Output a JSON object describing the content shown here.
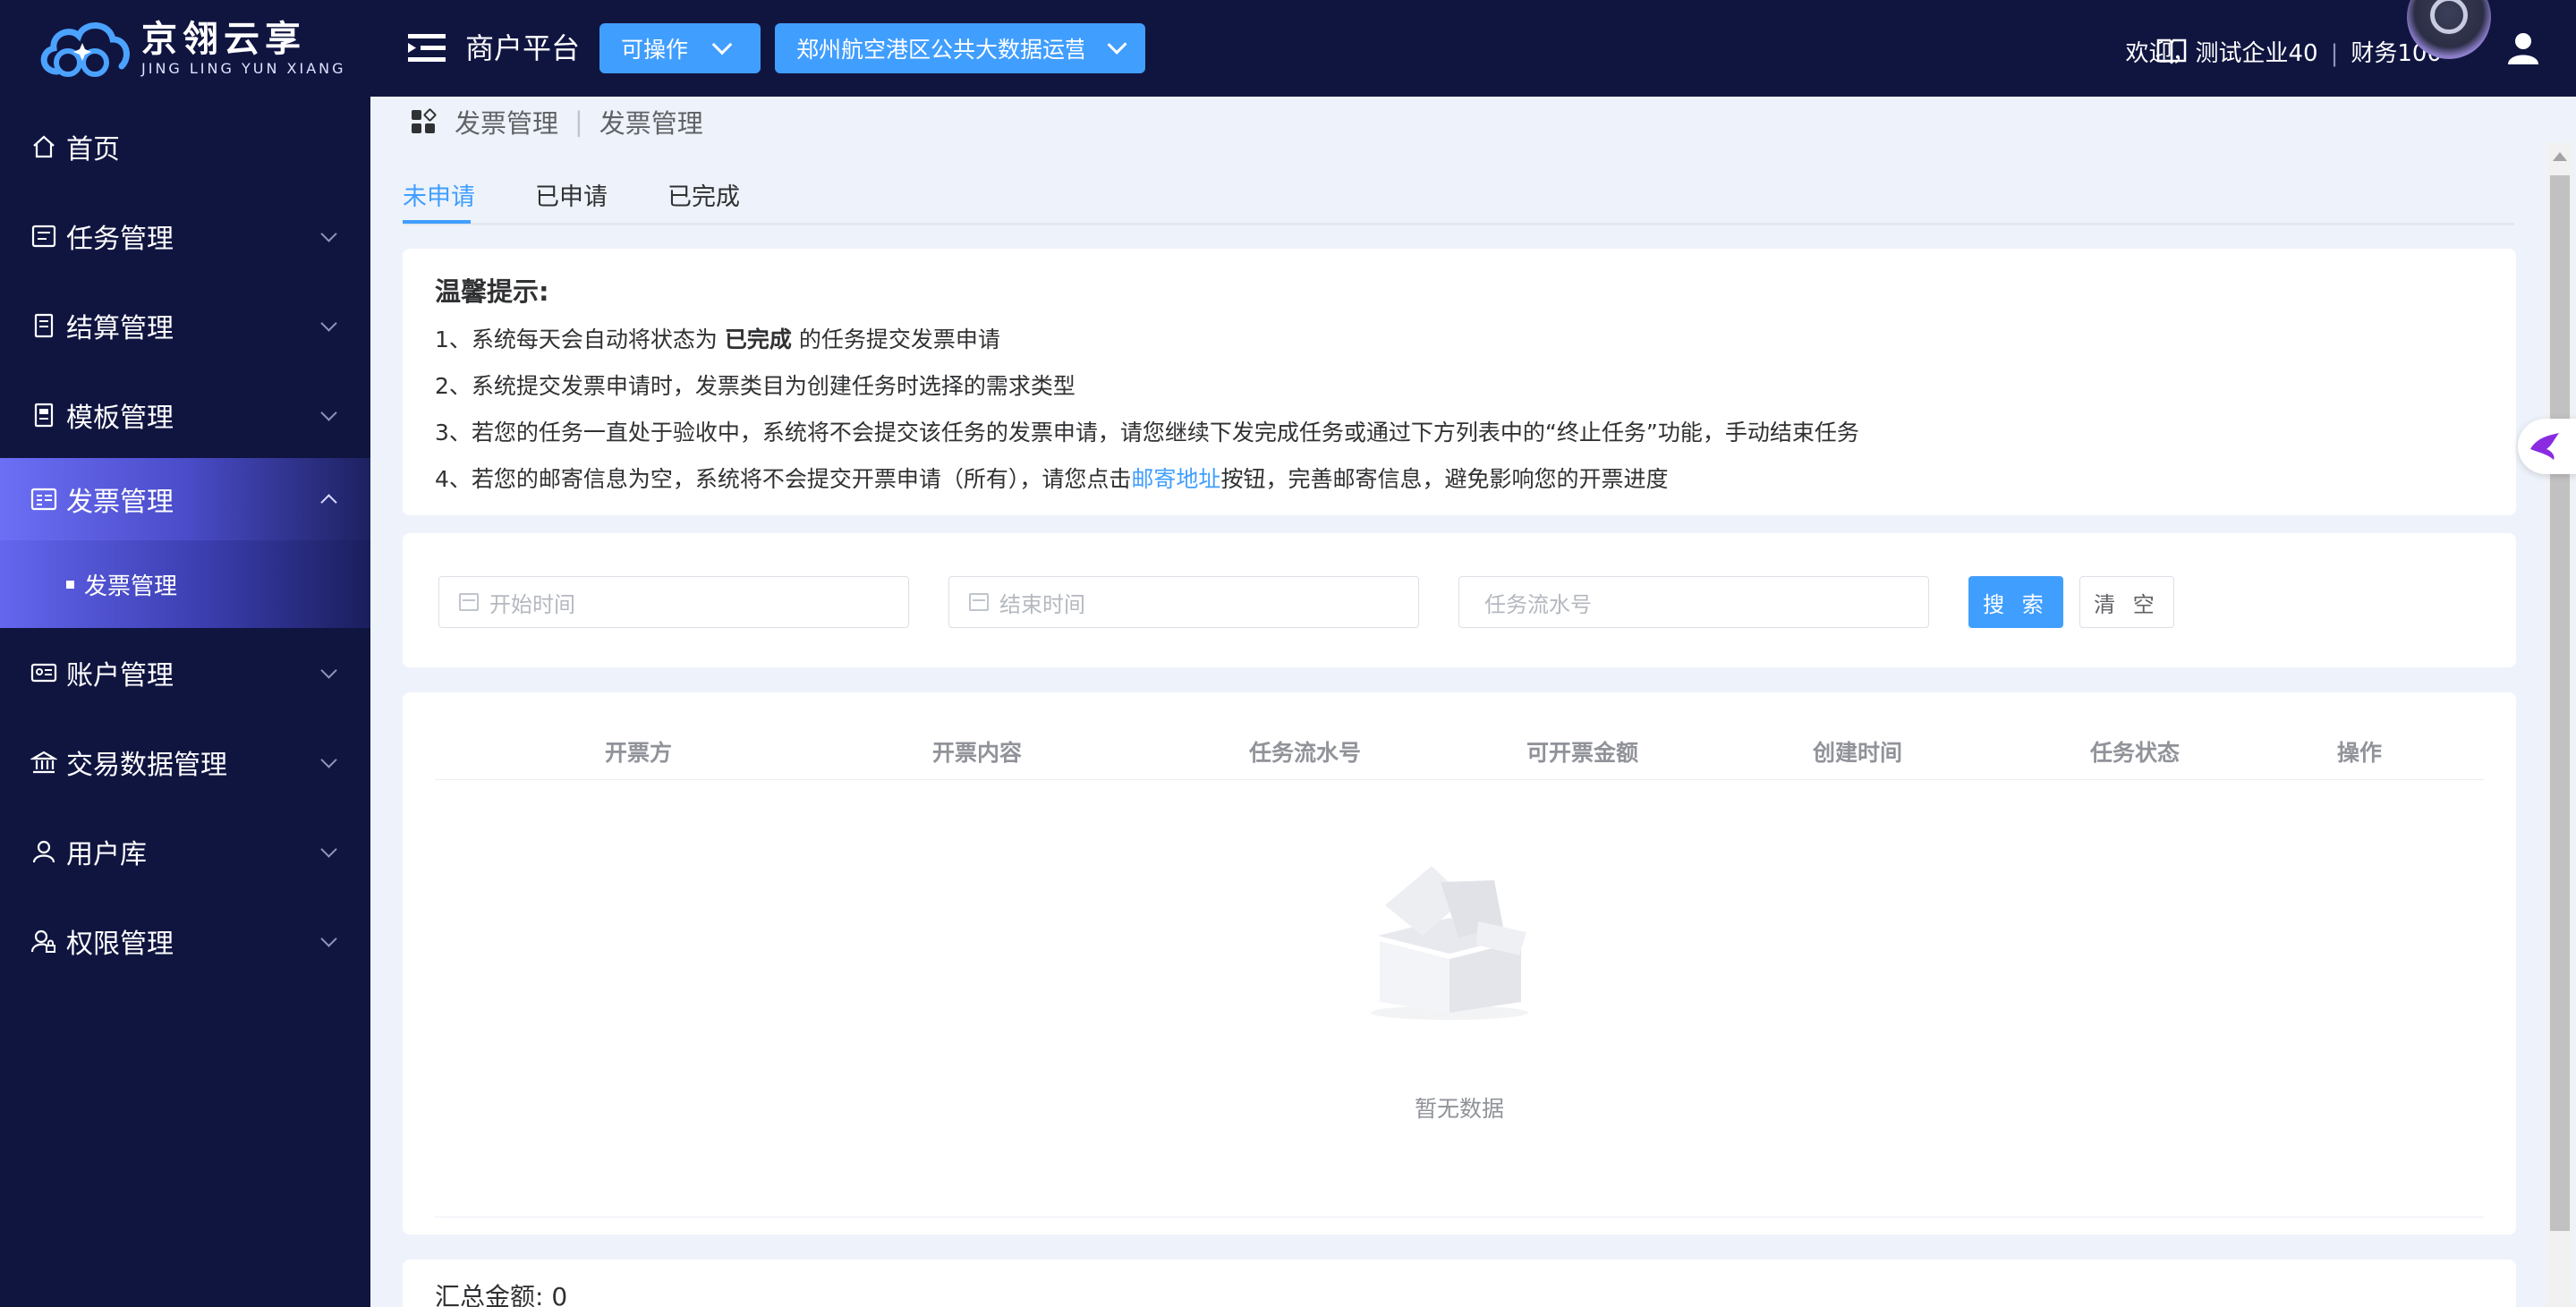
{
  "header": {
    "logo_cn": "京翎云享",
    "logo_en": "JING LING YUN XIANG",
    "platform_title": "商户平台",
    "operate_select": "可操作",
    "org_select": "郑州航空港区公共大数据运营有|",
    "welcome": "欢迎，测试企业40",
    "role": "财务100"
  },
  "sidebar": {
    "items": [
      {
        "label": "首页"
      },
      {
        "label": "任务管理"
      },
      {
        "label": "结算管理"
      },
      {
        "label": "模板管理"
      },
      {
        "label": "发票管理"
      },
      {
        "label": "账户管理"
      },
      {
        "label": "交易数据管理"
      },
      {
        "label": "用户库"
      },
      {
        "label": "权限管理"
      }
    ],
    "sub_item": "发票管理"
  },
  "breadcrumb": {
    "first": "发票管理",
    "second": "发票管理"
  },
  "tabs": [
    {
      "label": "未申请"
    },
    {
      "label": "已申请"
    },
    {
      "label": "已完成"
    }
  ],
  "tips": {
    "title": "温馨提示:",
    "line1_pre": "1、系统每天会自动将状态为 ",
    "line1_bold": "已完成",
    "line1_post": " 的任务提交发票申请",
    "line2": "2、系统提交发票申请时，发票类目为创建任务时选择的需求类型",
    "line3": "3、若您的任务一直处于验收中，系统将不会提交该任务的发票申请，请您继续下发完成任务或通过下方列表中的“终止任务”功能，手动结束任务",
    "line4_pre": "4、若您的邮寄信息为空，系统将不会提交开票申请（所有），请您点击",
    "line4_link": "邮寄地址",
    "line4_post": "按钮，完善邮寄信息，避免影响您的开票进度"
  },
  "filter": {
    "start_placeholder": "开始时间",
    "end_placeholder": "结束时间",
    "serial_placeholder": "任务流水号",
    "search_label": "搜 索",
    "clear_label": "清 空"
  },
  "table": {
    "columns": [
      "开票方",
      "开票内容",
      "任务流水号",
      "可开票金额",
      "创建时间",
      "任务状态",
      "操作"
    ],
    "empty_text": "暂无数据"
  },
  "summary": "汇总金额: 0",
  "colors": {
    "sidebar_bg": "#101540",
    "accent": "#409eff",
    "active_gradient": "#6c6ff5"
  }
}
